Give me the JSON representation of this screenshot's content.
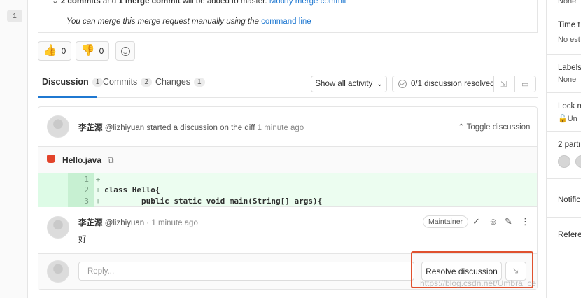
{
  "left_gutter": {
    "badge": "1"
  },
  "merge": {
    "commits_bold": "2 commits",
    "and_text": " and ",
    "merge_commit_bold": "1 merge commit",
    "will_be_added": " will be added to master. ",
    "modify_link": "Modify merge commit",
    "manual_text": "You can merge this merge request manually using the ",
    "command_line_link": "command line"
  },
  "awards": [
    {
      "emoji": "👍",
      "count": "0"
    },
    {
      "emoji": "👎",
      "count": "0"
    }
  ],
  "tabs": [
    {
      "label": "Discussion",
      "count": "1"
    },
    {
      "label": "Commits",
      "count": "2"
    },
    {
      "label": "Changes",
      "count": "1"
    }
  ],
  "toolbar": {
    "show_activity": "Show all activity",
    "resolved_status": "0/1 discussion resolved"
  },
  "discussion": {
    "author": "李芷源",
    "handle": "@lizhiyuan",
    "started_text": " started a discussion on the diff ",
    "time": "1 minute ago",
    "toggle": "Toggle discussion",
    "file_name": "Hello.java",
    "diff_lines": [
      {
        "num": "1",
        "code": ""
      },
      {
        "num": "2",
        "code": "class Hello{"
      },
      {
        "num": "3",
        "code": "        public static void main(String[] args){"
      }
    ],
    "note": {
      "author": "李芷源",
      "handle": "@lizhiyuan",
      "separator": " · ",
      "time": "1 minute ago",
      "role": "Maintainer",
      "body": "好"
    },
    "reply_placeholder": "Reply...",
    "resolve_button": "Resolve discussion"
  },
  "watermark": "https://blog.csdn.net/Umbra_ce",
  "right_sidebar": {
    "none_top": "None",
    "time_title": "Time t",
    "time_value": "No est",
    "labels_title": "Labels",
    "labels_value": "None",
    "lock_title": "Lock m",
    "lock_value": "Un",
    "participants_title": "2 parti",
    "notifications_title": "Notific",
    "reference_title": "Refere"
  },
  "colors": {
    "accent": "#1f78d1",
    "highlight": "#e0512e",
    "diff_added": "#ecfdf0"
  }
}
